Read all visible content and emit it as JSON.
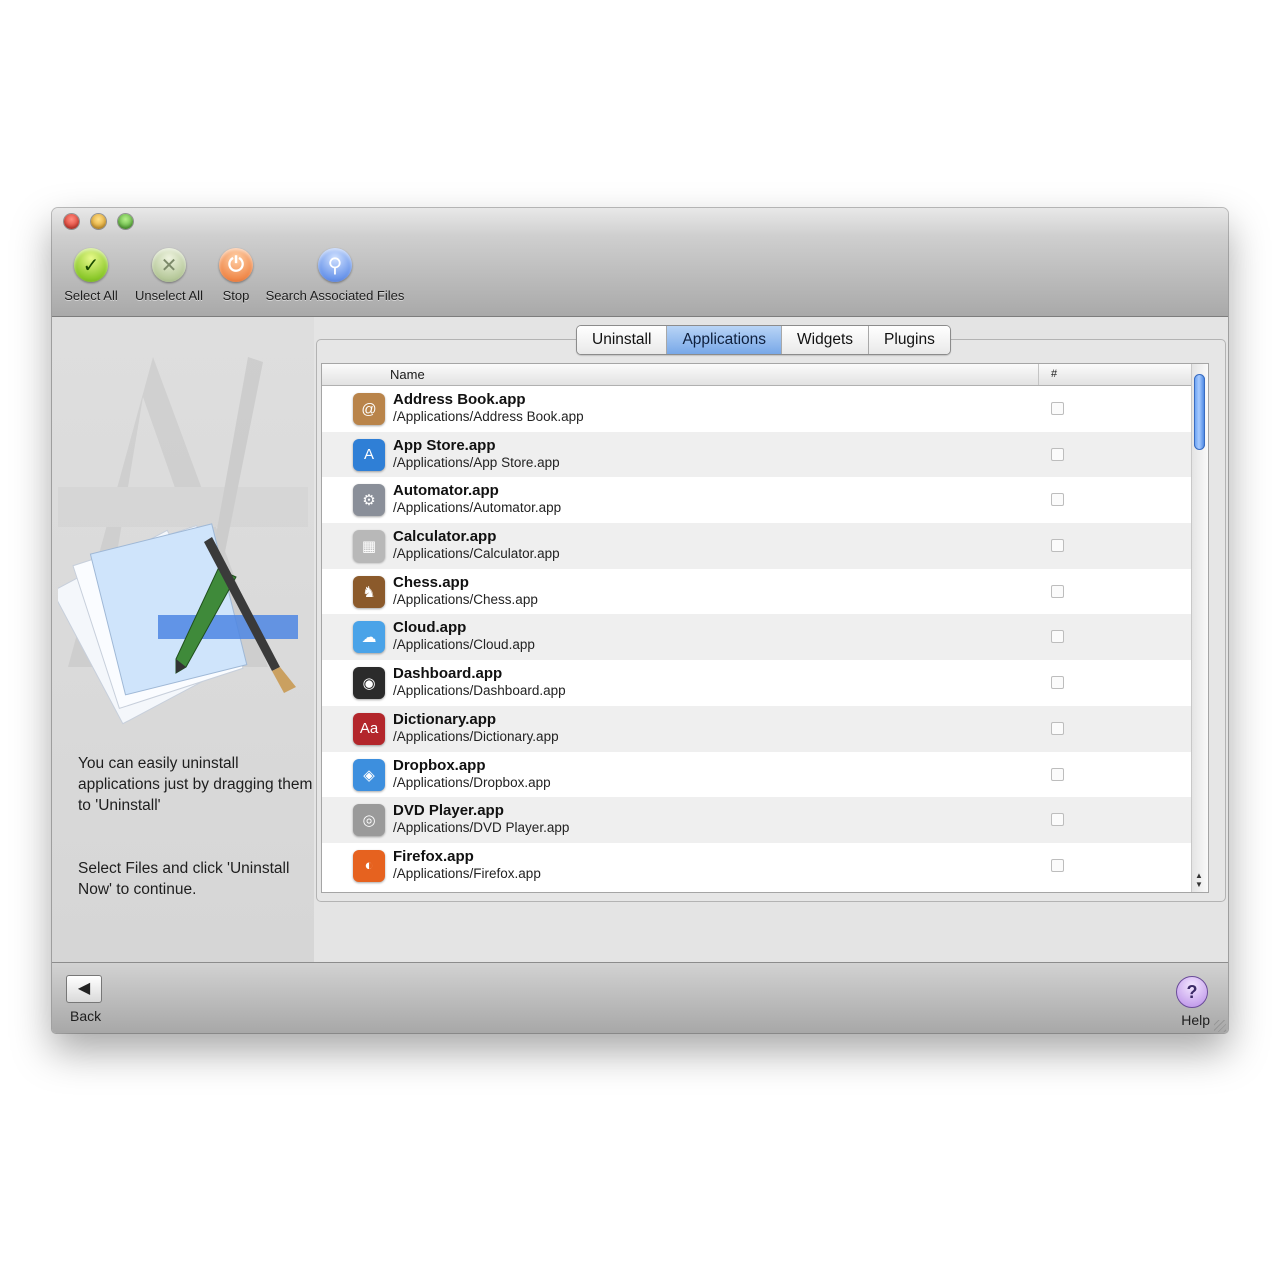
{
  "toolbar": {
    "items": [
      {
        "label": "Select All",
        "icon": "checkmark-icon"
      },
      {
        "label": "Unselect All",
        "icon": "cross-icon"
      },
      {
        "label": "Stop",
        "icon": "power-icon"
      },
      {
        "label": "Search Associated Files",
        "icon": "magnifier-icon"
      }
    ]
  },
  "sidebar": {
    "hint1": "You can easily uninstall applications just by dragging them to 'Uninstall'",
    "hint2": "Select Files and click 'Uninstall Now' to continue."
  },
  "tabs": [
    "Uninstall",
    "Applications",
    "Widgets",
    "Plugins"
  ],
  "active_tab": "Applications",
  "table": {
    "col_name": "Name",
    "col_hash": "#",
    "rows": [
      {
        "name": "Address Book.app",
        "path": "/Applications/Address Book.app",
        "icon": "address-book-icon",
        "color": "#b9844a"
      },
      {
        "name": "App Store.app",
        "path": "/Applications/App Store.app",
        "icon": "app-store-icon",
        "color": "#2f7fd6"
      },
      {
        "name": "Automator.app",
        "path": "/Applications/Automator.app",
        "icon": "automator-icon",
        "color": "#8a8f99"
      },
      {
        "name": "Calculator.app",
        "path": "/Applications/Calculator.app",
        "icon": "calculator-icon",
        "color": "#b8b8b8"
      },
      {
        "name": "Chess.app",
        "path": "/Applications/Chess.app",
        "icon": "chess-icon",
        "color": "#8b5a2b"
      },
      {
        "name": "Cloud.app",
        "path": "/Applications/Cloud.app",
        "icon": "cloud-icon",
        "color": "#4aa3e8"
      },
      {
        "name": "Dashboard.app",
        "path": "/Applications/Dashboard.app",
        "icon": "dashboard-icon",
        "color": "#2b2b2b"
      },
      {
        "name": "Dictionary.app",
        "path": "/Applications/Dictionary.app",
        "icon": "dictionary-icon",
        "color": "#b3262b"
      },
      {
        "name": "Dropbox.app",
        "path": "/Applications/Dropbox.app",
        "icon": "dropbox-icon",
        "color": "#3d8fde"
      },
      {
        "name": "DVD Player.app",
        "path": "/Applications/DVD Player.app",
        "icon": "dvd-player-icon",
        "color": "#9a9a9a"
      },
      {
        "name": "Firefox.app",
        "path": "/Applications/Firefox.app",
        "icon": "firefox-icon",
        "color": "#e6621f"
      }
    ]
  },
  "footer": {
    "back_label": "Back",
    "help_label": "Help"
  }
}
